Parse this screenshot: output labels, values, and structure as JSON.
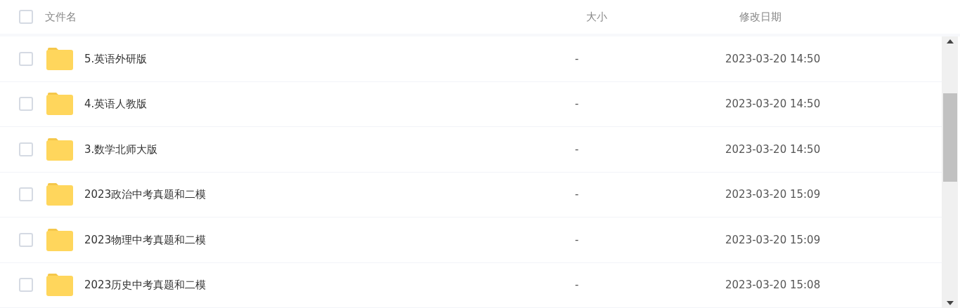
{
  "header": {
    "checked": false,
    "columns": [
      "文件名",
      "大小",
      "修改日期"
    ]
  },
  "rows": [
    {
      "name": "5.英语外研版",
      "size": "-",
      "modified": "2023-03-20 14:50",
      "checked": false
    },
    {
      "name": "4.英语人教版",
      "size": "-",
      "modified": "2023-03-20 14:50",
      "checked": false
    },
    {
      "name": "3.数学北师大版",
      "size": "-",
      "modified": "2023-03-20 14:50",
      "checked": false
    },
    {
      "name": "2023政治中考真题和二模",
      "size": "-",
      "modified": "2023-03-20 15:09",
      "checked": false
    },
    {
      "name": "2023物理中考真题和二模",
      "size": "-",
      "modified": "2023-03-20 15:09",
      "checked": false
    },
    {
      "name": "2023历史中考真题和二模",
      "size": "-",
      "modified": "2023-03-20 15:08",
      "checked": false
    }
  ]
}
